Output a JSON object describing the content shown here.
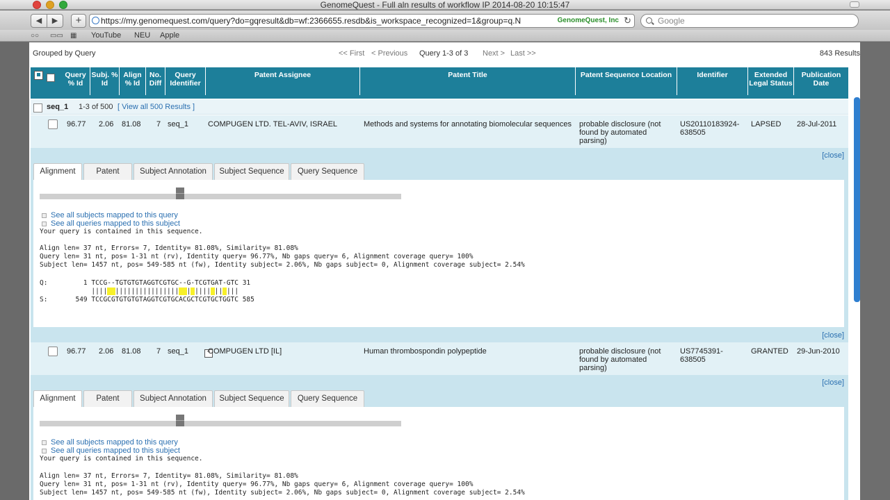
{
  "browser": {
    "title": "GenomeQuest - Full aln results of workflow IP 2014-08-20 10:15:47",
    "url": "https://my.genomequest.com/query?do=gqresult&db=wf:2366655.resdb&is_workspace_recognized=1&group=q.N",
    "cert": "GenomeQuest, Inc",
    "search_placeholder": "Google",
    "bookmarks": [
      "YouTube",
      "NEU",
      "Apple"
    ]
  },
  "pager": {
    "grouped": "Grouped by Query",
    "first": "<< First",
    "previous": "< Previous",
    "page": "Query 1-3 of 3",
    "next": "Next >",
    "last": "Last >>",
    "results": "843 Results"
  },
  "columns": {
    "query_id": "Query % Id",
    "subj_id": "Subj. % Id",
    "align_id": "Align % Id",
    "no_diff": "No. Diff",
    "query_identifier": "Query Identifier",
    "assignee": "Patent Assignee",
    "title": "Patent Title",
    "location": "Patent Sequence Location",
    "identifier": "Identifier",
    "legal": "Extended Legal Status",
    "pubdate": "Publication Date"
  },
  "group": {
    "seq": "seq_1",
    "range": "1-3 of 500",
    "view_all": "[ View all 500 Results ]"
  },
  "rows": [
    {
      "query_id": "96.77",
      "subj_id": "2.06",
      "align_id": "81.08",
      "no_diff": "7",
      "query_identifier": "seq_1",
      "assignee": "COMPUGEN LTD. TEL-AVIV, ISRAEL",
      "title": "Methods and systems for annotating biomolecular sequences",
      "location": "probable disclosure (not found by automated parsing)",
      "identifier": "US20110183924-638505",
      "legal": "LAPSED",
      "pubdate": "28-Jul-2011"
    },
    {
      "query_id": "96.77",
      "subj_id": "2.06",
      "align_id": "81.08",
      "no_diff": "7",
      "query_identifier": "seq_1",
      "assignee": "COMPUGEN LTD [IL]",
      "title": "Human thrombospondin polypeptide",
      "location": "probable disclosure (not found by automated parsing)",
      "identifier": "US7745391-638505",
      "legal": "GRANTED",
      "pubdate": "29-Jun-2010"
    }
  ],
  "close_label": "[close]",
  "tabs": [
    "Alignment",
    "Patent",
    "Subject Annotation",
    "Subject Sequence",
    "Query Sequence"
  ],
  "alignment": {
    "link_subjects": "See all subjects mapped to this query",
    "link_queries": "See all queries mapped to this subject",
    "contained": "Your query is contained in this sequence.",
    "align_len": "Align len= 37 nt, Errors= 7, Identity= 81.08%, Similarity= 81.08%",
    "query_len": "Query len= 31 nt, pos= 1-31 nt (rv), Identity query= 96.77%, Nb gaps query= 6, Alignment coverage query= 100%",
    "subject_len": "Subject len= 1457 nt, pos= 549-585 nt (fw), Identity subject= 2.06%, Nb gaps subject= 0, Alignment coverage subject= 2.54%",
    "q_line": "Q:         1 TCCG--TGTGTGTAGGTCGTGC--G-TCGTGAT-GTC 31",
    "s_line": "S:       549 TCCGCGTGTGTGTAGGTCGTGCACGCTCGTGCTGGTC 585"
  }
}
